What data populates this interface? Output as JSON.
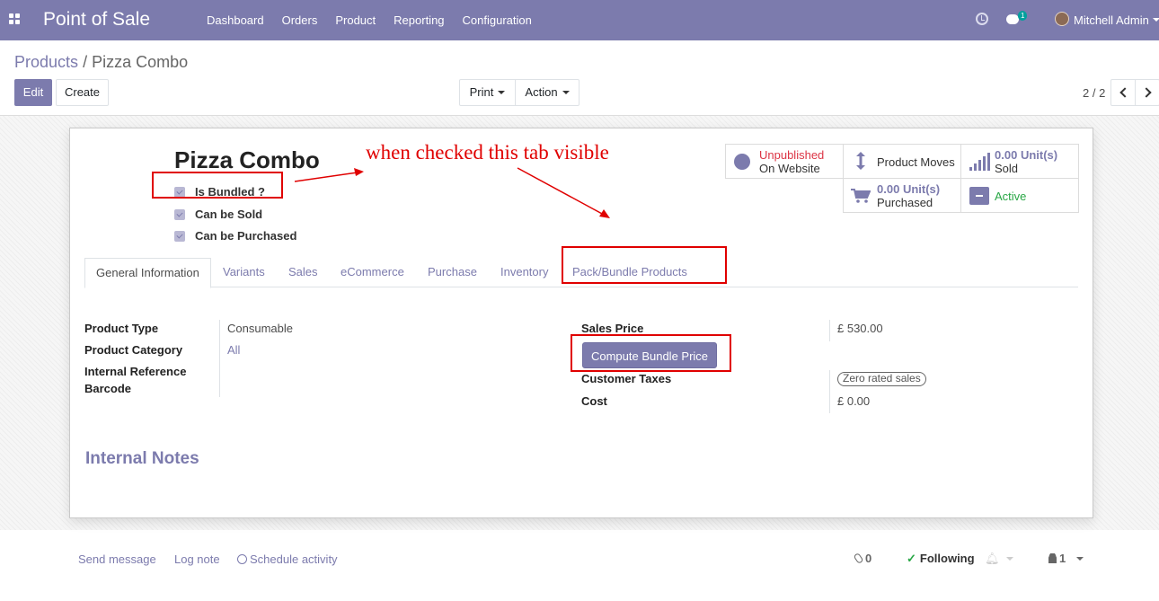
{
  "navbar": {
    "app_title": "Point of Sale",
    "menu": [
      "Dashboard",
      "Orders",
      "Product",
      "Reporting",
      "Configuration"
    ],
    "chat_count": "1",
    "user_name": "Mitchell Admin"
  },
  "breadcrumb": {
    "parent": "Products",
    "separator": "/",
    "current": "Pizza Combo"
  },
  "toolbar": {
    "edit": "Edit",
    "create": "Create",
    "print": "Print",
    "action": "Action",
    "pager": "2 / 2"
  },
  "product": {
    "name": "Pizza Combo",
    "checkboxes": [
      "Is Bundled ?",
      "Can be Sold",
      "Can be Purchased"
    ]
  },
  "smart_buttons": {
    "website_status": "Unpublished",
    "website_label": "On Website",
    "moves_label": "Product Moves",
    "sold_value": "0.00",
    "sold_unit": "Unit(s)",
    "sold_label": "Sold",
    "purchased_value": "0.00",
    "purchased_unit": "Unit(s)",
    "purchased_label": "Purchased",
    "active_label": "Active"
  },
  "annotation": {
    "text": "when checked this tab visible"
  },
  "tabs": [
    "General Information",
    "Variants",
    "Sales",
    "eCommerce",
    "Purchase",
    "Inventory",
    "Pack/Bundle Products"
  ],
  "fields_left": {
    "product_type_label": "Product Type",
    "product_type_value": "Consumable",
    "category_label": "Product Category",
    "category_value": "All",
    "internal_ref_label": "Internal Reference",
    "barcode_label": "Barcode"
  },
  "fields_right": {
    "sales_price_label": "Sales Price",
    "sales_price_value": "£ 530.00",
    "compute_button": "Compute Bundle Price",
    "customer_taxes_label": "Customer Taxes",
    "customer_taxes_tag": "Zero rated sales",
    "cost_label": "Cost",
    "cost_value": "£ 0.00"
  },
  "internal_notes": "Internal Notes",
  "chatter": {
    "send_message": "Send message",
    "log_note": "Log note",
    "schedule_activity": "Schedule activity",
    "attachments": "0",
    "following": "Following",
    "followers": "1"
  },
  "colors": {
    "primary": "#7c7bad",
    "danger": "#dc3545",
    "success": "#28a745",
    "annotation": "#e00000"
  }
}
